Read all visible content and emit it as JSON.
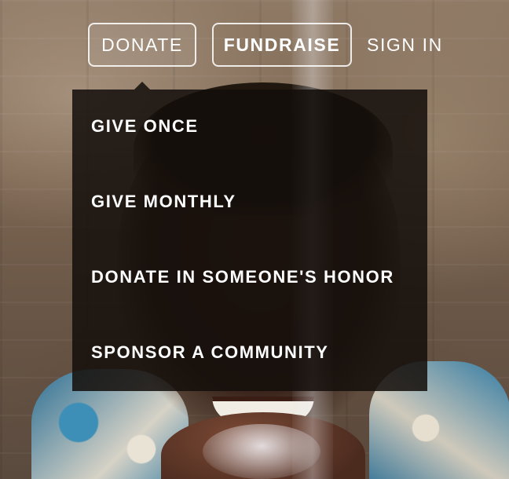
{
  "nav": {
    "donate_label": "DONATE",
    "fundraise_label": "FUNDRAISE",
    "signin_label": "SIGN IN"
  },
  "donate_menu": {
    "items": [
      {
        "label": "GIVE ONCE"
      },
      {
        "label": "GIVE MONTHLY"
      },
      {
        "label": "DONATE IN SOMEONE'S HONOR"
      },
      {
        "label": "SPONSOR A COMMUNITY"
      }
    ]
  },
  "colors": {
    "menu_background": "#140e0a",
    "text": "#ffffff",
    "button_border": "#ffffff"
  }
}
